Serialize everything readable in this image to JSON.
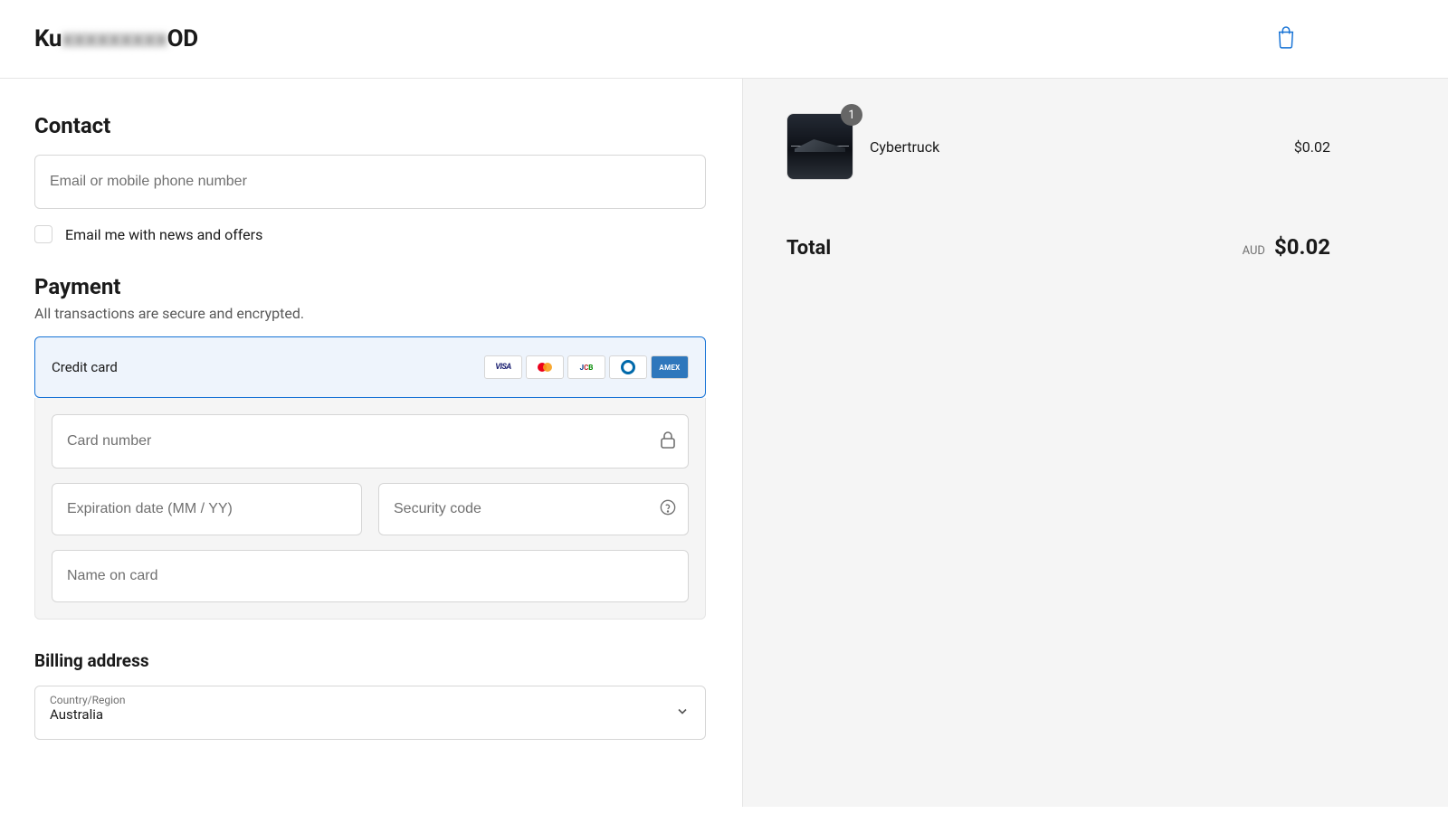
{
  "brand": {
    "prefix": "Ku",
    "suffix": "OD"
  },
  "contact": {
    "heading": "Contact",
    "email_placeholder": "Email or mobile phone number",
    "newsletter_label": "Email me with news and offers"
  },
  "payment": {
    "heading": "Payment",
    "subtext": "All transactions are secure and encrypted.",
    "cc_label": "Credit card",
    "card_number_placeholder": "Card number",
    "expiry_placeholder": "Expiration date (MM / YY)",
    "cvv_placeholder": "Security code",
    "name_placeholder": "Name on card",
    "cards": {
      "visa": "VISA",
      "jcb": "JCB",
      "amex": "AMEX"
    }
  },
  "billing": {
    "heading": "Billing address",
    "country_label": "Country/Region",
    "country_value": "Australia"
  },
  "order": {
    "item": {
      "name": "Cybertruck",
      "qty": "1",
      "price": "$0.02"
    },
    "total_label": "Total",
    "currency": "AUD",
    "total_amount": "$0.02"
  }
}
